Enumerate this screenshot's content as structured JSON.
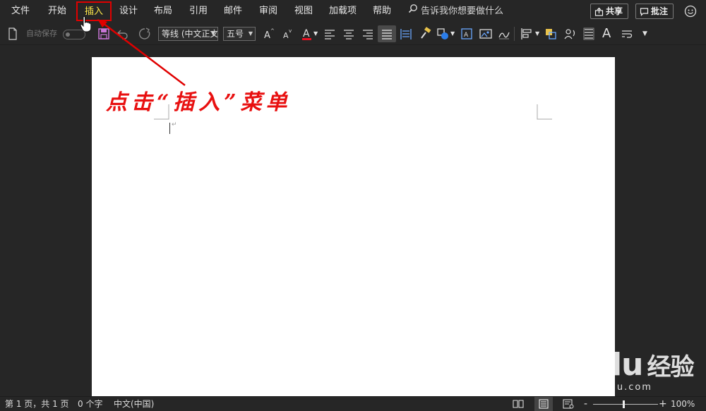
{
  "menu": {
    "items": [
      "文件",
      "开始",
      "插入",
      "设计",
      "布局",
      "引用",
      "邮件",
      "审阅",
      "视图",
      "加载项",
      "帮助"
    ],
    "active_index": 2,
    "tell_me": "告诉我你想要做什么",
    "share_label": "共享",
    "comments_label": "批注"
  },
  "toolbar": {
    "autosave_label": "自动保存",
    "font_name": "等线 (中文正文",
    "font_size": "五号",
    "style_glyph": "A",
    "font_color_glyph": "A"
  },
  "document": {
    "annotation": "点击“插入”菜单",
    "annotation_color": "#e81010",
    "paragraph_mark": "↵"
  },
  "status": {
    "page_info": "第 1 页，共 1 页",
    "word_count": "0 个字",
    "language": "中文(中国)",
    "zoom_percent": "100%",
    "zoom_minus": "-",
    "zoom_plus": "+"
  },
  "watermark": {
    "logo": "Bai du",
    "logo_suffix": "经验",
    "url": "jingyan.baidu.com"
  },
  "colors": {
    "background": "#262626",
    "active_menu_text": "#ffe94a",
    "highlight_border": "#e00000"
  }
}
